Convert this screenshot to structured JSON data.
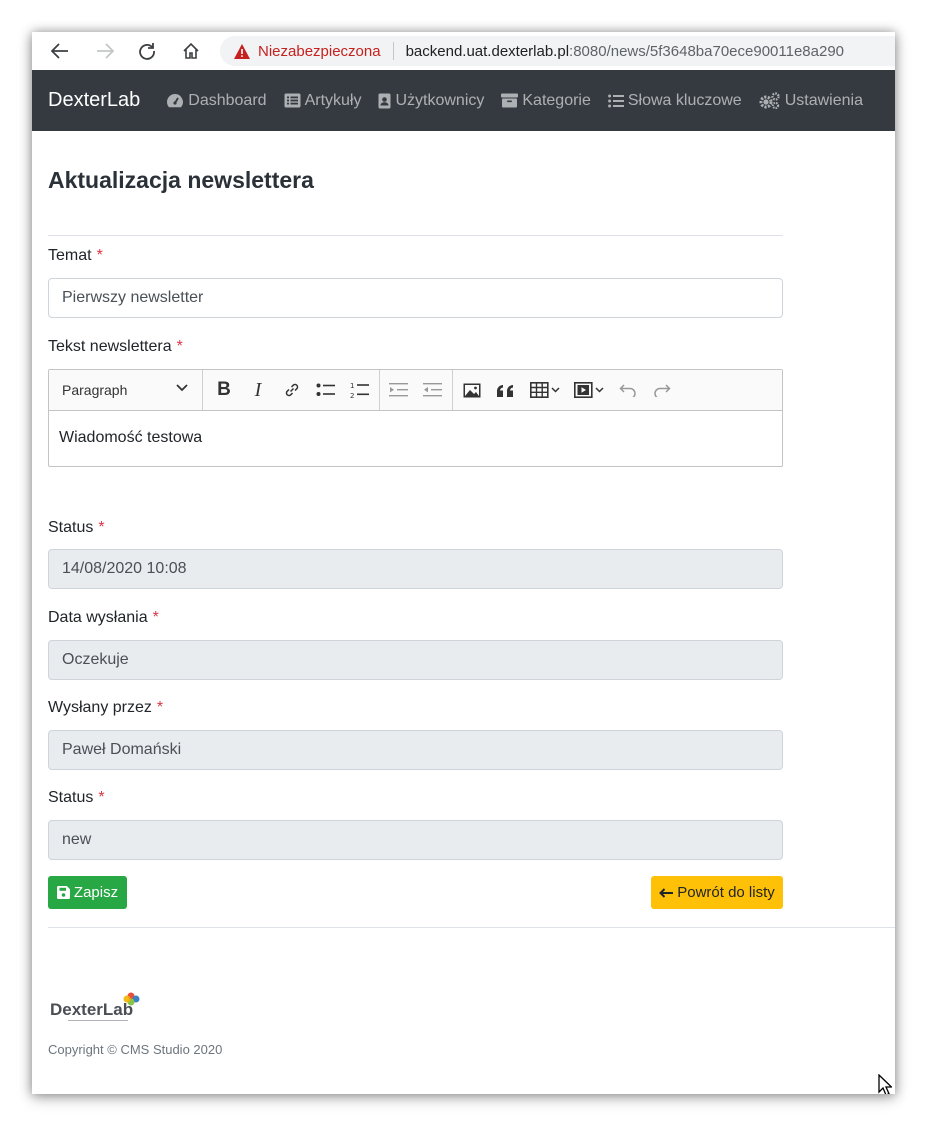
{
  "browser": {
    "security_label": "Niezabezpieczona",
    "url_host": "backend.uat.dexterlab.pl",
    "url_rest": ":8080/news/5f3648ba70ece90011e8a290"
  },
  "navbar": {
    "brand": "DexterLab",
    "items": [
      {
        "label": "Dashboard",
        "icon": "dashboard-icon"
      },
      {
        "label": "Artykuły",
        "icon": "list-alt-icon"
      },
      {
        "label": "Użytkownicy",
        "icon": "id-badge-icon"
      },
      {
        "label": "Kategorie",
        "icon": "archive-icon"
      },
      {
        "label": "Słowa kluczowe",
        "icon": "list-icon"
      },
      {
        "label": "Ustawienia",
        "icon": "cogs-icon"
      }
    ]
  },
  "page": {
    "title": "Aktualizacja newslettera"
  },
  "form": {
    "required_mark": "*",
    "subject": {
      "label": "Temat",
      "value": "Pierwszy newsletter"
    },
    "body": {
      "label": "Tekst newslettera",
      "paragraph_select": "Paragraph",
      "content": "Wiadomość testowa"
    },
    "status_date": {
      "label": "Status",
      "value": "14/08/2020 10:08"
    },
    "send_date": {
      "label": "Data wysłania",
      "value": "Oczekuje"
    },
    "sent_by": {
      "label": "Wysłany przez",
      "value": "Paweł Domański"
    },
    "status": {
      "label": "Status",
      "value": "new"
    }
  },
  "buttons": {
    "save": "Zapisz",
    "back": "Powrót do listy"
  },
  "footer": {
    "logo_text": "DexterLab",
    "copyright": "Copyright © CMS Studio 2020"
  },
  "colors": {
    "navbar": "#343a40",
    "save": "#28a745",
    "back": "#ffc107",
    "required": "#dc3545"
  }
}
